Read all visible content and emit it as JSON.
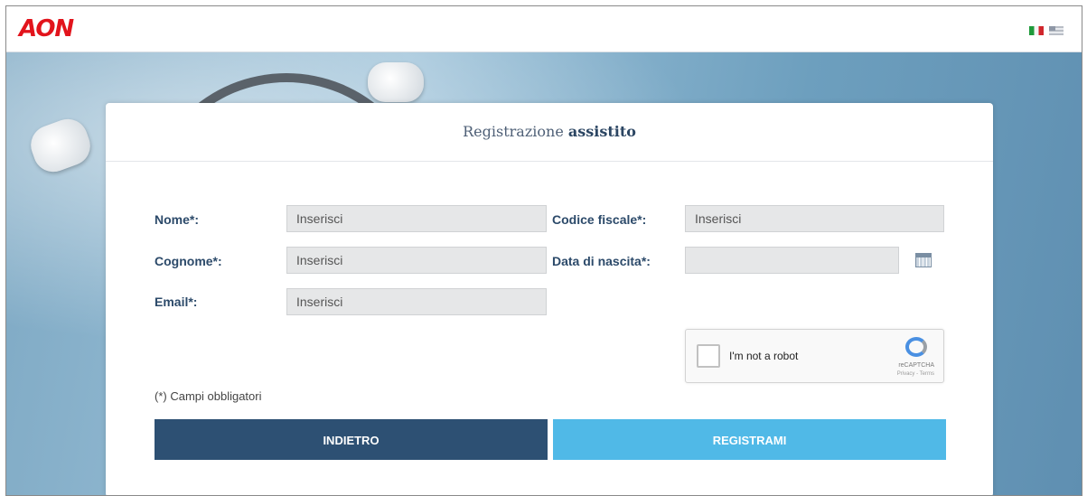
{
  "header": {
    "logo_text": "AON",
    "languages": [
      "it",
      "en"
    ]
  },
  "form": {
    "title_regular": "Registrazione",
    "title_bold": "assistito",
    "fields": {
      "nome": {
        "label": "Nome*:",
        "placeholder": "Inserisci"
      },
      "cognome": {
        "label": "Cognome*:",
        "placeholder": "Inserisci"
      },
      "email": {
        "label": "Email*:",
        "placeholder": "Inserisci"
      },
      "codice_fiscale": {
        "label": "Codice fiscale*:",
        "placeholder": "Inserisci"
      },
      "data_nascita": {
        "label": "Data di nascita*:",
        "placeholder": ""
      }
    },
    "captcha": {
      "label": "I'm not a robot",
      "brand": "reCAPTCHA",
      "terms": "Privacy - Terms"
    },
    "required_note": "(*) Campi obbligatori",
    "buttons": {
      "back": "INDIETRO",
      "register": "REGISTRAMI"
    }
  },
  "colors": {
    "brand_red": "#e2141c",
    "primary_dark": "#2d5073",
    "primary_light": "#50b9e7"
  }
}
